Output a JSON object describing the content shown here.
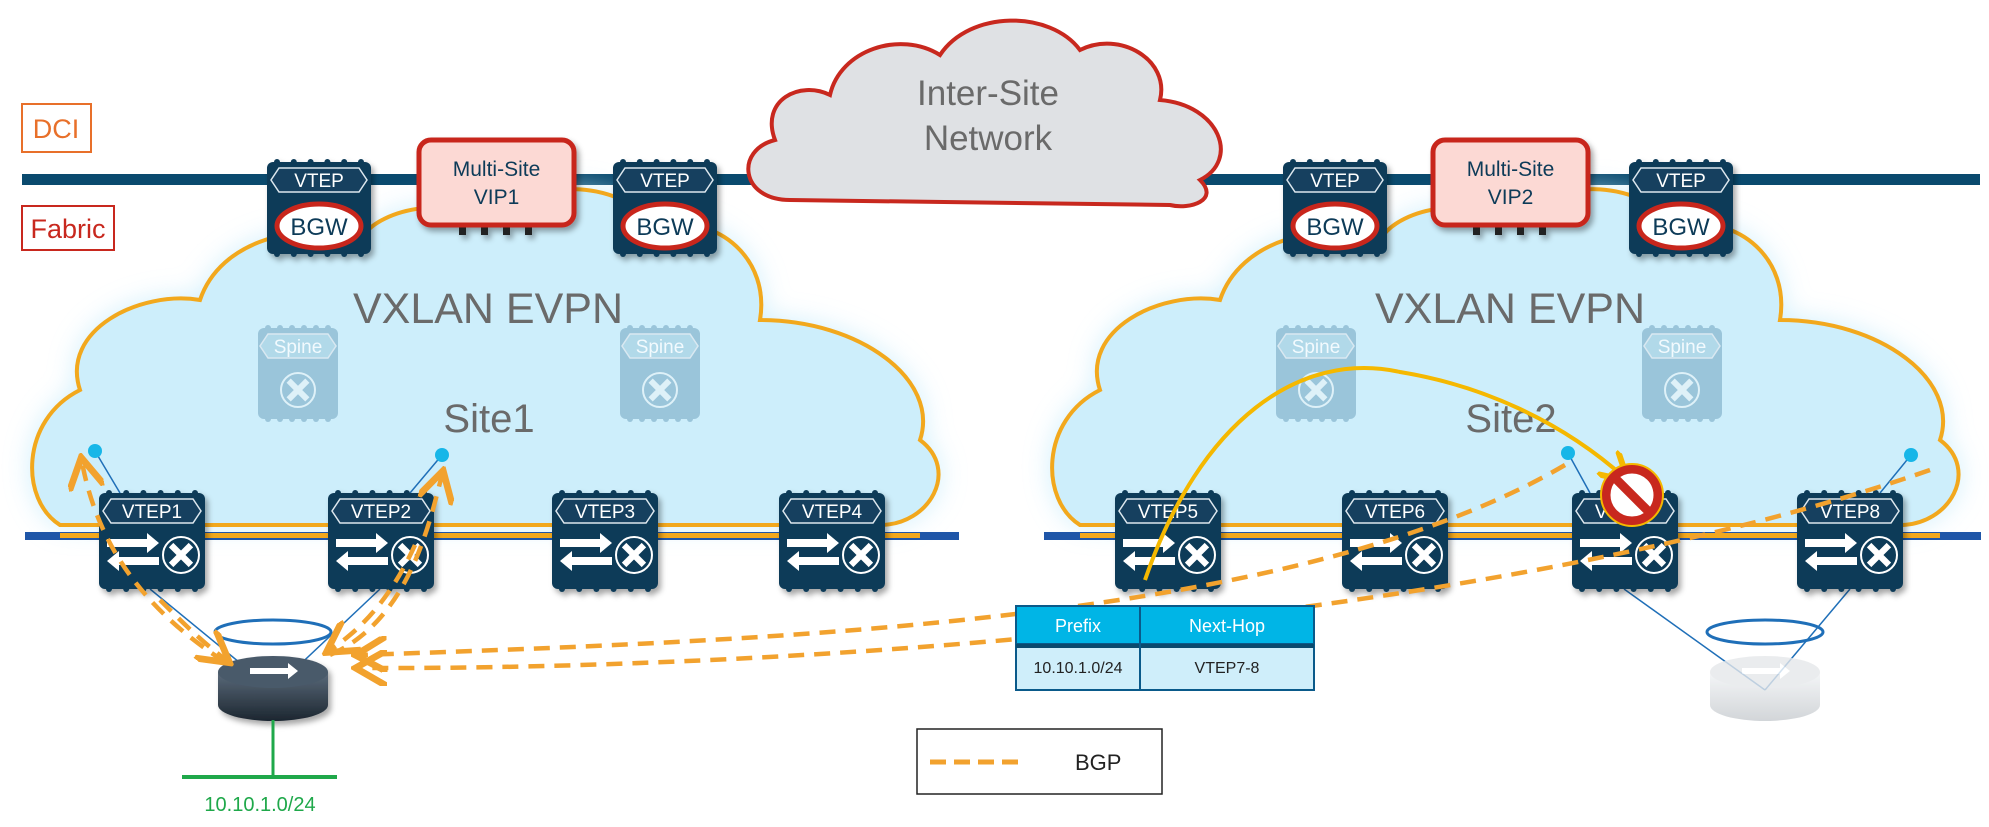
{
  "labels": {
    "dci": "DCI",
    "fabric": "Fabric",
    "inter_site_line1": "Inter-Site",
    "inter_site_line2": "Network",
    "site1_overlay": "VXLAN EVPN",
    "site2_overlay": "VXLAN EVPN",
    "site1": "Site1",
    "site2": "Site2",
    "host_subnet": "10.10.1.0/24"
  },
  "vips": [
    {
      "line1": "Multi-Site",
      "line2": "VIP1"
    },
    {
      "line1": "Multi-Site",
      "line2": "VIP2"
    }
  ],
  "bgws": [
    {
      "tag": "VTEP",
      "role": "BGW"
    },
    {
      "tag": "VTEP",
      "role": "BGW"
    },
    {
      "tag": "VTEP",
      "role": "BGW"
    },
    {
      "tag": "VTEP",
      "role": "BGW"
    }
  ],
  "spines": [
    {
      "tag": "Spine"
    },
    {
      "tag": "Spine"
    },
    {
      "tag": "Spine"
    },
    {
      "tag": "Spine"
    }
  ],
  "leafs": [
    {
      "tag": "VTEP1"
    },
    {
      "tag": "VTEP2"
    },
    {
      "tag": "VTEP3"
    },
    {
      "tag": "VTEP4"
    },
    {
      "tag": "VTEP5"
    },
    {
      "tag": "VTEP6"
    },
    {
      "tag": "VTEP7"
    },
    {
      "tag": "VTEP8"
    }
  ],
  "route_table": {
    "headers": [
      "Prefix",
      "Next-Hop"
    ],
    "rows": [
      [
        "10.10.1.0/24",
        "VTEP7-8"
      ]
    ]
  },
  "legend": {
    "bgp": "BGP"
  },
  "colors": {
    "dci": "#e8702a",
    "fabric": "#c8281e",
    "switch": "#0d3b58",
    "cloud_fill": "#cdeefb",
    "fabric_outline": "#f2a81d",
    "bgp": "#f2a22e",
    "host_subnet": "#1fa84a",
    "table_header": "#00b5e6",
    "table_row": "#cfeefa"
  },
  "icons": {
    "leaf": "layer3-switch-icon",
    "spine": "spine-switch-icon",
    "router": "router-icon",
    "blocked": "prohibited-icon",
    "cloud": "cloud-icon"
  }
}
